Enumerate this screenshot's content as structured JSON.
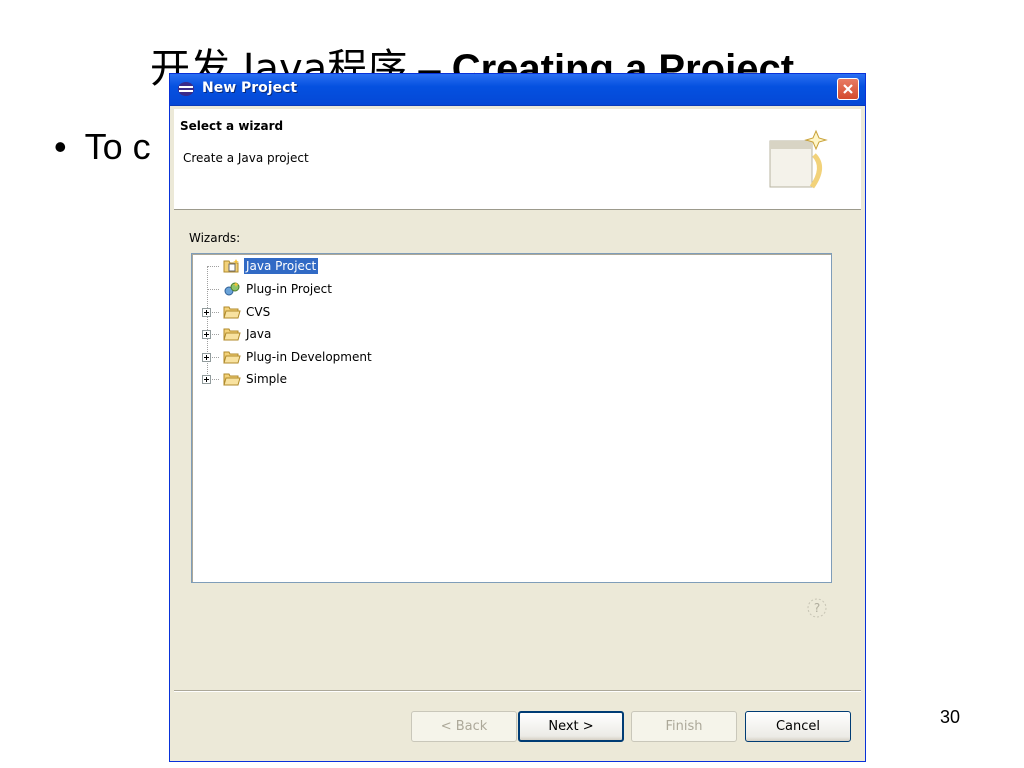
{
  "slide": {
    "title_cn": "开发 Java程序",
    "title_sep": " – ",
    "title_en": "Creating a Project",
    "bullet_text": "To c",
    "page_number": "30"
  },
  "dialog": {
    "title": "New Project",
    "header": {
      "title": "Select a wizard",
      "description": "Create a Java project"
    },
    "wizards_label": "Wizards:",
    "tree": [
      {
        "label": "Java Project",
        "icon": "java-project-icon",
        "expandable": false,
        "selected": true
      },
      {
        "label": "Plug-in Project",
        "icon": "plugin-project-icon",
        "expandable": false,
        "selected": false
      },
      {
        "label": "CVS",
        "icon": "folder-icon",
        "expandable": true,
        "selected": false
      },
      {
        "label": "Java",
        "icon": "folder-icon",
        "expandable": true,
        "selected": false
      },
      {
        "label": "Plug-in Development",
        "icon": "folder-icon",
        "expandable": true,
        "selected": false
      },
      {
        "label": "Simple",
        "icon": "folder-icon",
        "expandable": true,
        "selected": false
      }
    ],
    "buttons": {
      "back": "< Back",
      "next": "Next >",
      "finish": "Finish",
      "cancel": "Cancel"
    }
  },
  "colors": {
    "titlebar": "#0551e0",
    "selection": "#316AC5",
    "dialog_bg": "#ECE9D8"
  }
}
